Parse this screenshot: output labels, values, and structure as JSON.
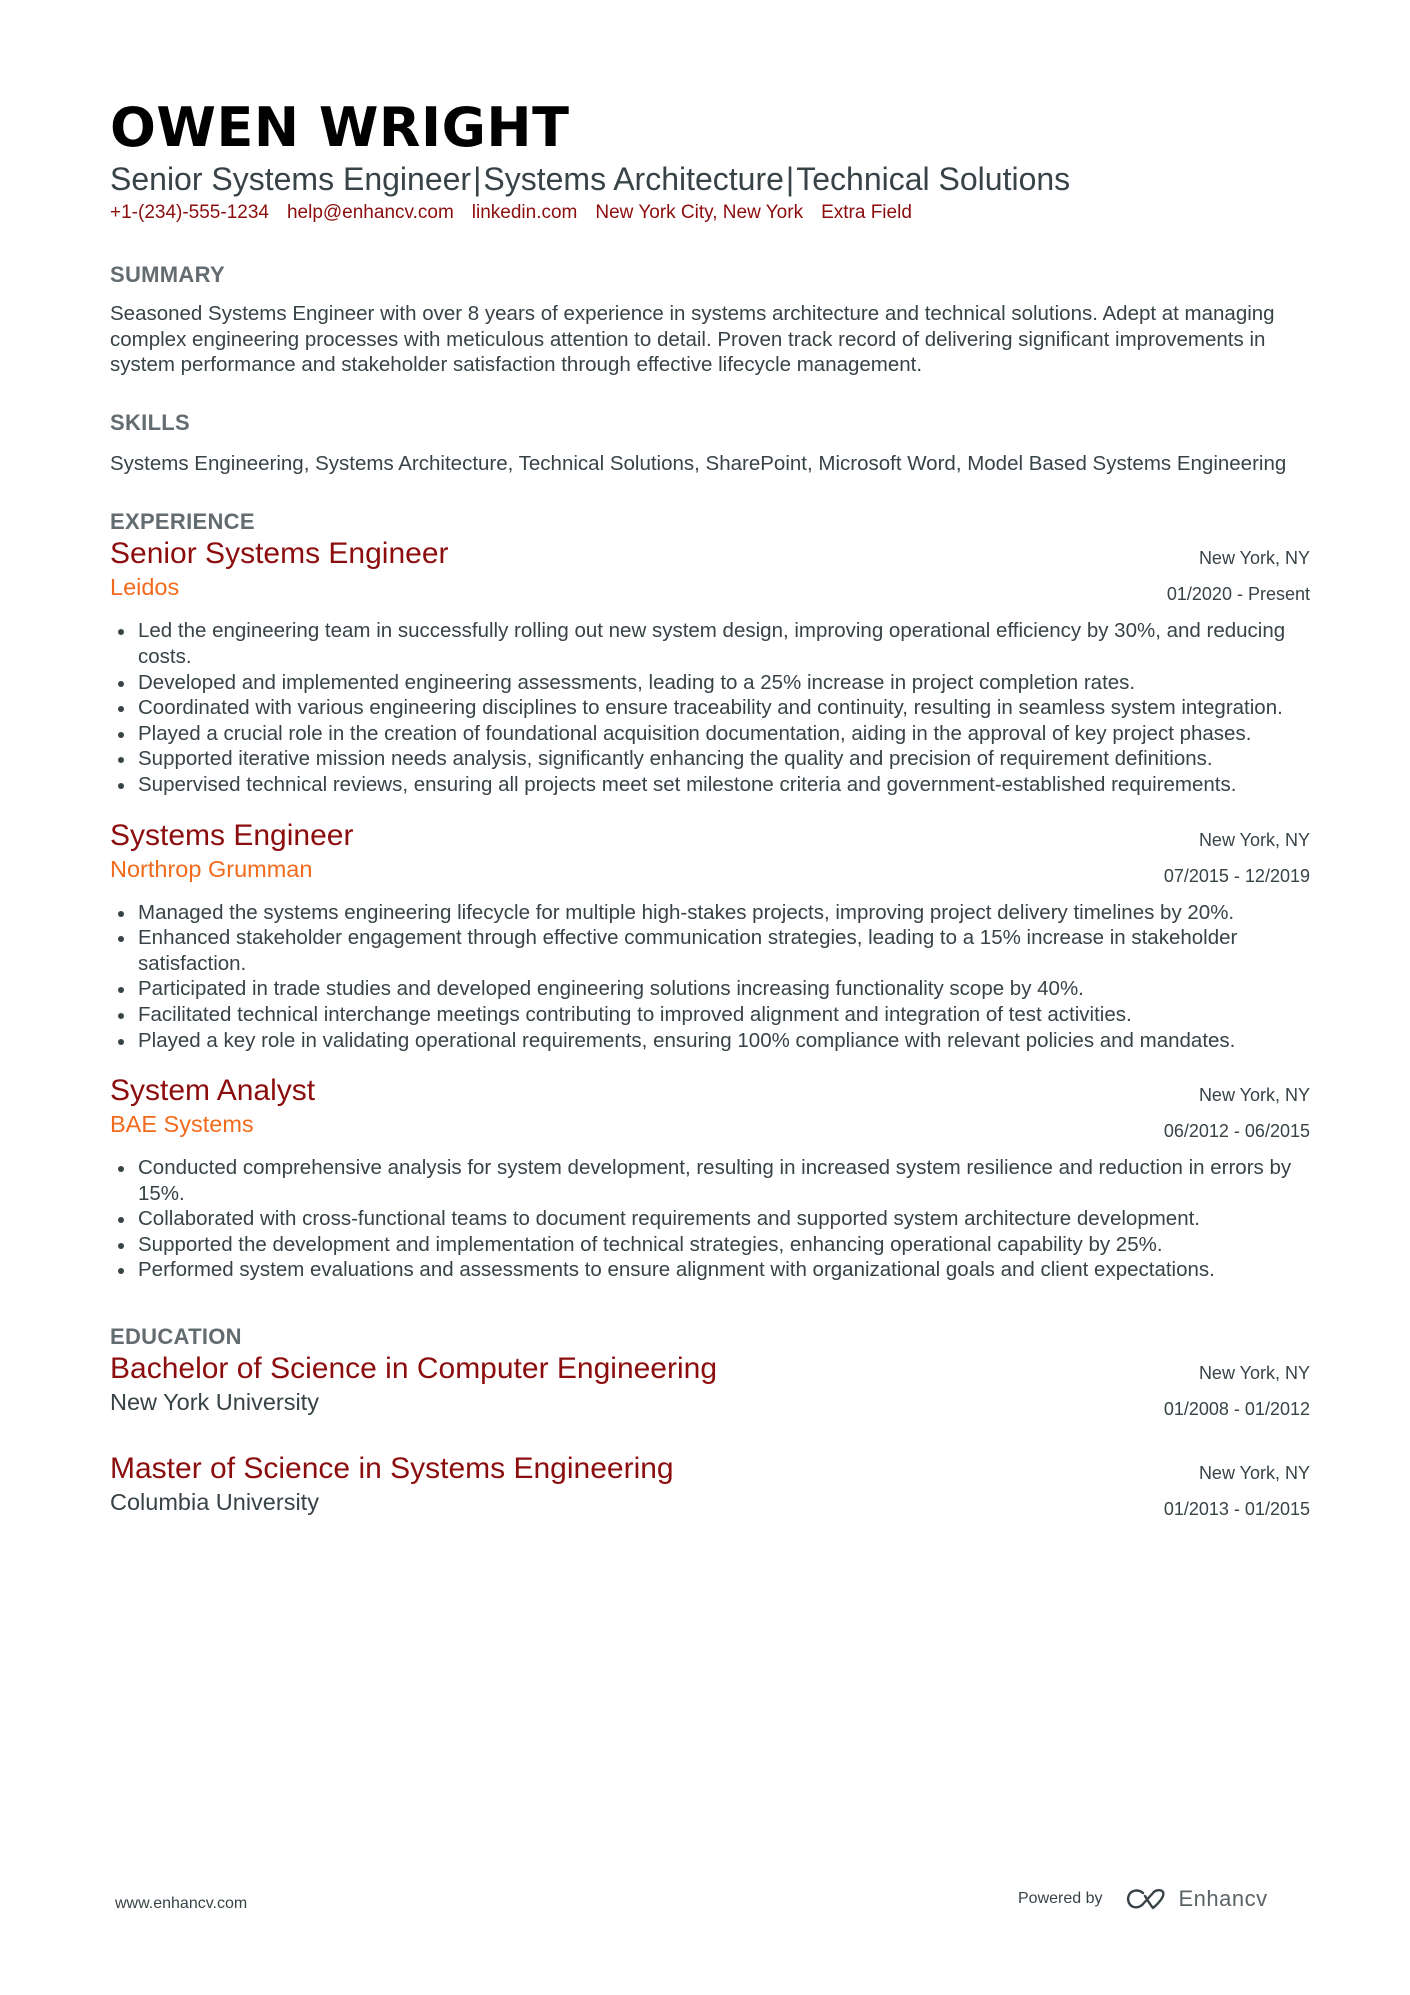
{
  "header": {
    "name": "OWEN WRIGHT",
    "subtitle_parts": [
      "Senior Systems Engineer",
      "Systems Architecture",
      "Technical Solutions"
    ],
    "separator": "|",
    "contacts": [
      "+1-(234)-555-1234",
      "help@enhancv.com",
      "linkedin.com",
      "New York City, New York",
      "Extra Field"
    ]
  },
  "summary": {
    "heading": "SUMMARY",
    "text": "Seasoned Systems Engineer with over 8 years of experience in systems architecture and technical solutions. Adept at managing complex engineering processes with meticulous attention to detail. Proven track record of delivering significant improvements in system performance and stakeholder satisfaction through effective lifecycle management."
  },
  "skills": {
    "heading": "SKILLS",
    "text": "Systems Engineering, Systems Architecture, Technical Solutions, SharePoint, Microsoft Word, Model Based Systems Engineering"
  },
  "experience": {
    "heading": "EXPERIENCE",
    "jobs": [
      {
        "title": "Senior Systems Engineer",
        "company": "Leidos",
        "location": "New York, NY",
        "dates": "01/2020 - Present",
        "bullets": [
          "Led the engineering team in successfully rolling out new system design, improving operational efficiency by 30%, and reducing costs.",
          "Developed and implemented engineering assessments, leading to a 25% increase in project completion rates.",
          "Coordinated with various engineering disciplines to ensure traceability and continuity, resulting in seamless system integration.",
          "Played a crucial role in the creation of foundational acquisition documentation, aiding in the approval of key project phases.",
          "Supported iterative mission needs analysis, significantly enhancing the quality and precision of requirement definitions.",
          "Supervised technical reviews, ensuring all projects meet set milestone criteria and government-established requirements."
        ]
      },
      {
        "title": "Systems Engineer",
        "company": "Northrop Grumman",
        "location": "New York, NY",
        "dates": "07/2015 - 12/2019",
        "bullets": [
          "Managed the systems engineering lifecycle for multiple high-stakes projects, improving project delivery timelines by 20%.",
          "Enhanced stakeholder engagement through effective communication strategies, leading to a 15% increase in stakeholder satisfaction.",
          "Participated in trade studies and developed engineering solutions increasing functionality scope by 40%.",
          "Facilitated technical interchange meetings contributing to improved alignment and integration of test activities.",
          "Played a key role in validating operational requirements, ensuring 100% compliance with relevant policies and mandates."
        ]
      },
      {
        "title": "System Analyst",
        "company": "BAE Systems",
        "location": "New York, NY",
        "dates": "06/2012 - 06/2015",
        "bullets": [
          "Conducted comprehensive analysis for system development, resulting in increased system resilience and reduction in errors by 15%.",
          "Collaborated with cross-functional teams to document requirements and supported system architecture development.",
          "Supported the development and implementation of technical strategies, enhancing operational capability by 25%.",
          "Performed system evaluations and assessments to ensure alignment with organizational goals and client expectations."
        ]
      }
    ]
  },
  "education": {
    "heading": "EDUCATION",
    "items": [
      {
        "degree": "Bachelor of Science in Computer Engineering",
        "school": "New York University",
        "location": "New York, NY",
        "dates": "01/2008 - 01/2012"
      },
      {
        "degree": "Master of Science in Systems Engineering",
        "school": "Columbia University",
        "location": "New York, NY",
        "dates": "01/2013 - 01/2015"
      }
    ]
  },
  "footer": {
    "website": "www.enhancv.com",
    "powered_by": "Powered by",
    "brand": "Enhancv",
    "brand_icon": "enhancv-logo-icon"
  },
  "colors": {
    "accent_title": "#8c0d0d",
    "accent_company": "#f26a1b",
    "heading_gray": "#636c70",
    "body_text": "#384347"
  }
}
